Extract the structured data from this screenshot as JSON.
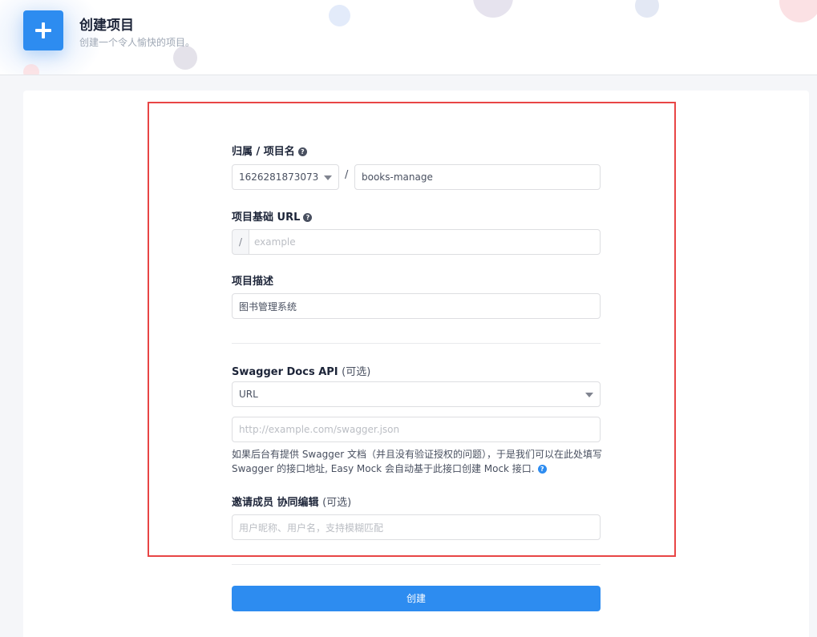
{
  "header": {
    "title": "创建项目",
    "subtitle": "创建一个令人愉快的项目。",
    "icon": "plus-icon"
  },
  "form": {
    "owner_project": {
      "label": "归属 / 项目名",
      "owner_value": "1626281873073",
      "separator": "/",
      "project_name_value": "books-manage"
    },
    "base_url": {
      "label": "项目基础 URL",
      "prefix": "/",
      "placeholder": "example"
    },
    "description": {
      "label": "项目描述",
      "value": "图书管理系统"
    },
    "swagger": {
      "label": "Swagger Docs API",
      "optional": "(可选)",
      "type_value": "URL",
      "url_placeholder": "http://example.com/swagger.json",
      "tip_line1": "如果后台有提供 Swagger 文档（并且没有验证授权的问题），于是我们可以在此处填写",
      "tip_line2": "Swagger 的接口地址, Easy Mock 会自动基于此接口创建 Mock 接口."
    },
    "members": {
      "label": "邀请成员 协同编辑",
      "optional": "(可选)",
      "placeholder": "用户昵称、用户名，支持模糊匹配"
    },
    "submit_label": "创建"
  },
  "colors": {
    "primary": "#2d8cf0",
    "highlight_border": "#e84545"
  }
}
